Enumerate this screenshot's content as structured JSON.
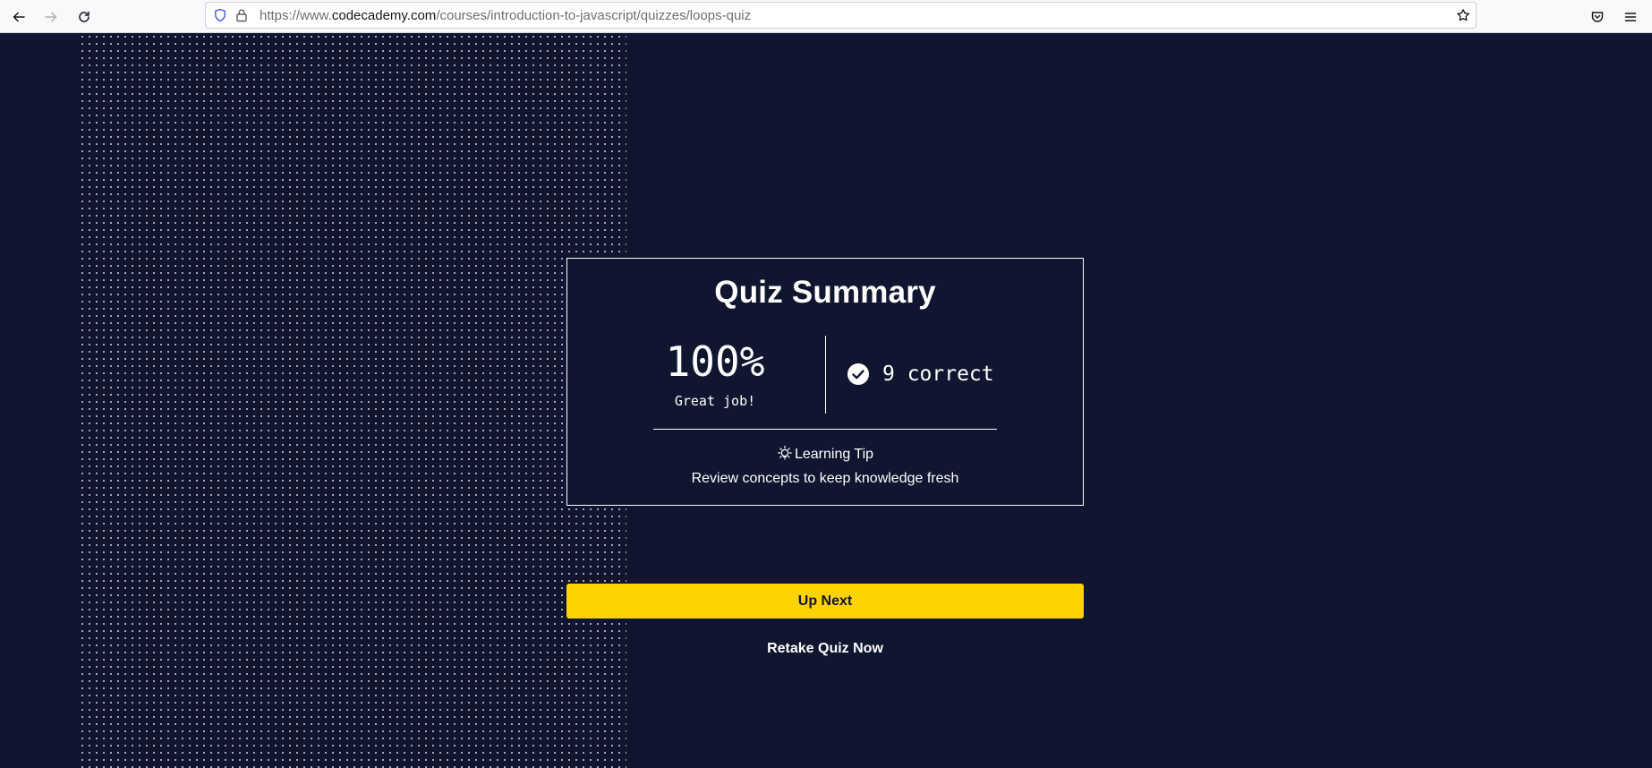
{
  "browser": {
    "url_prefix": "https://www.",
    "url_host": "codecademy.com",
    "url_path": "/courses/introduction-to-javascript/quizzes/loops-quiz",
    "icons": [
      "back-icon",
      "forward-icon",
      "reload-icon",
      "tracking-shield-icon",
      "lock-icon",
      "bookmark-star-icon",
      "pocket-icon",
      "menu-icon"
    ]
  },
  "summary": {
    "title": "Quiz Summary",
    "score": "100%",
    "score_caption": "Great job!",
    "correct_text": "9 correct",
    "tip_label": "Learning Tip",
    "tip_text": "Review concepts to keep knowledge fresh"
  },
  "actions": {
    "up_next_label": "Up Next",
    "retake_label": "Retake Quiz Now"
  },
  "colors": {
    "background": "#10162f",
    "accent_yellow": "#ffd300",
    "text": "#ffffff"
  }
}
